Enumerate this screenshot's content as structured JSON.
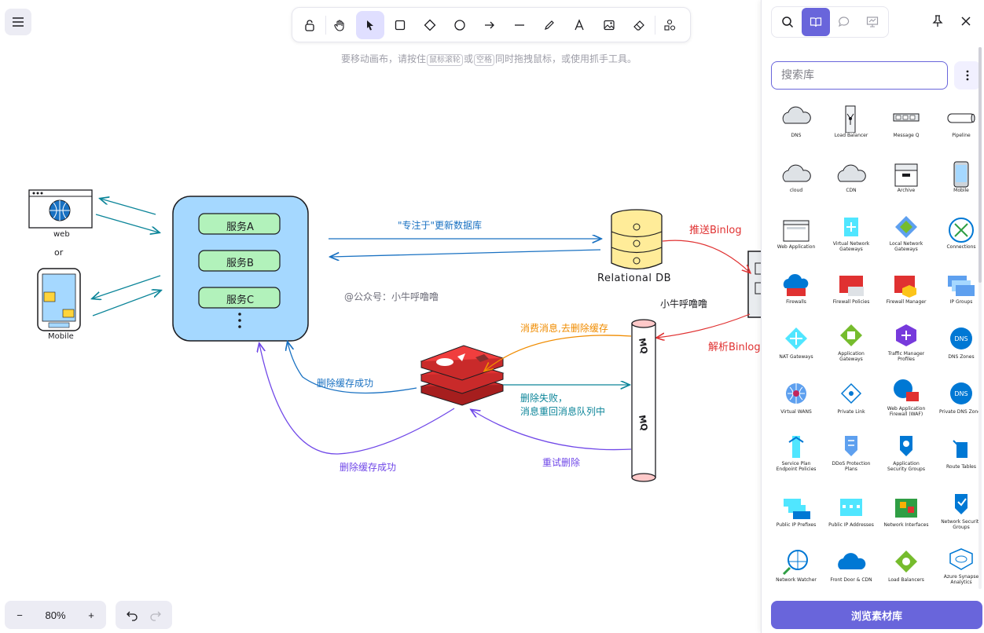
{
  "toolbar": {
    "tools": [
      "lock",
      "hand",
      "select",
      "rectangle",
      "diamond",
      "ellipse",
      "arrow",
      "line",
      "draw",
      "text",
      "image",
      "eraser",
      "extra-tools"
    ],
    "active_tool": "select",
    "hint_prefix": "要移动画布，请按住",
    "hint_key1": "鼠标滚轮",
    "hint_or": "或",
    "hint_key2": "空格",
    "hint_suffix": "同时拖拽鼠标，或使用抓手工具。"
  },
  "canvas": {
    "web_label": "web",
    "or_label": "or",
    "mobile_label": "Mobile",
    "services": [
      "服务A",
      "服务B",
      "服务C"
    ],
    "update_db_label": "\"专注于\"更新数据库",
    "db_label": "Relational DB",
    "push_binlog": "推送Binlog",
    "parse_binlog": "解析Binlog",
    "watermark": "@公众号：小牛呼噜噜",
    "author": "小牛呼噜噜",
    "consume_label": "消费消息,去删除缓存",
    "delete_success_1": "删除缓存成功",
    "delete_fail_line1": "删除失败，",
    "delete_fail_line2": "消息重回消息队列中",
    "retry_label": "重试删除",
    "delete_success_2": "删除缓存成功",
    "mq_label": "MQ"
  },
  "zoom": {
    "level": "80%",
    "minus": "−",
    "plus": "+"
  },
  "panel": {
    "tabs": [
      "search",
      "library",
      "comments",
      "presentation"
    ],
    "active_tab": "library",
    "search_placeholder": "搜索库",
    "browse_button": "浏览素材库",
    "items": [
      "DNS",
      "Load Balancer",
      "Message Q",
      "Pipeline",
      "cloud",
      "CDN",
      "Archive",
      "Mobile",
      "Web Application",
      "Virtual Network Gateways",
      "Local Network Gateways",
      "Connections",
      "Firewalls",
      "Firewall Policies",
      "Firewall Manager",
      "IP Groups",
      "NAT Gateways",
      "Application Gateways",
      "Traffic Manager Profiles",
      "DNS Zones",
      "Virtual WANS",
      "Private Link",
      "Web Application Firewall (WAF)",
      "Private DNS Zones",
      "Service Plan Endpoint Policies",
      "DDoS Protection Plans",
      "Application Security Groups",
      "Route Tables",
      "Public IP Prefixes",
      "Public IP Addresses",
      "Network Interfaces",
      "Network Security Groups",
      "Network Watcher",
      "Front Door & CDN",
      "Load Balancers",
      "Azure Synapse Analytics"
    ]
  },
  "colors": {
    "accent": "#6965db",
    "service_box": "#a5d8ff",
    "service_pill": "#b2f2bb",
    "db_yellow": "#ffec99",
    "redis_red": "#e03131",
    "mq_pink": "#ffc9c9",
    "blue_arrow": "#1971c2",
    "red_arrow": "#e03131",
    "orange_arrow": "#f08c00",
    "teal_arrow": "#0c8599",
    "purple_arrow": "#7048e8",
    "azure_blue": "#0078d4"
  }
}
